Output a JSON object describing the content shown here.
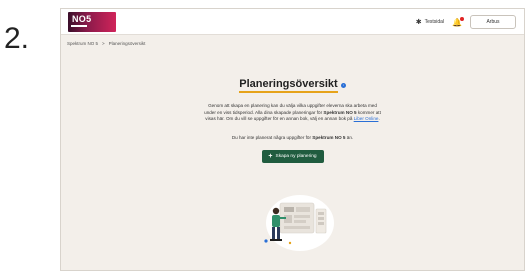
{
  "step_number": "2.",
  "header": {
    "logo_text": "NO5",
    "tests_label": "Testsidal",
    "account_label": "Arbus"
  },
  "breadcrumb": {
    "items": [
      "Spektrum NO 5",
      ">",
      "Planeringsöversikt"
    ]
  },
  "main": {
    "title": "Planeringsöversikt",
    "desc_part1": "Genom att skapa en planering kan du välja vilka uppgifter eleverna ska arbeta med under en viss tidsperiod. Alla dina skapade planeringar för ",
    "desc_bold": "Spektrum NO 5",
    "desc_part2": " kommer att visas här. Om du vill se uppgifter för en annan bok, välj en annan bok på ",
    "desc_link": "Liber Online",
    "desc_end": ".",
    "notice_part1": "Du har inte planerat några uppgifter för ",
    "notice_bold": "Spektrum NO 5",
    "notice_part2": " än.",
    "create_label": "Skapa ny planering"
  },
  "colors": {
    "page_bg": "#f3efea",
    "primary_button": "#205c3f",
    "title_underline": "#e6a31a",
    "link": "#2a6fd6",
    "notification_dot": "#e02424"
  },
  "icons": {
    "tests": "person-icon",
    "notifications": "bell-icon",
    "info": "info-icon",
    "create": "plus-icon"
  }
}
